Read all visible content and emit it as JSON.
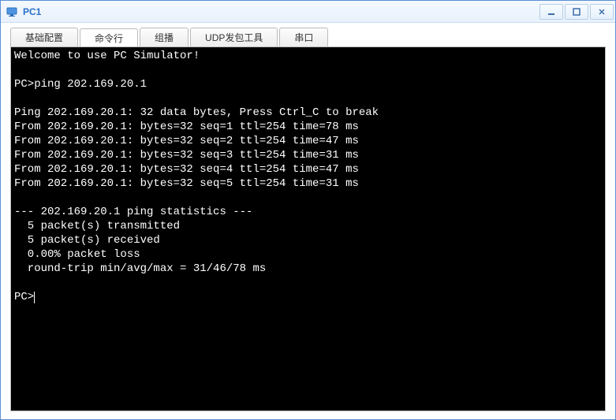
{
  "window": {
    "title": "PC1"
  },
  "tabs": [
    {
      "label": "基础配置",
      "active": false
    },
    {
      "label": "命令行",
      "active": true
    },
    {
      "label": "组播",
      "active": false
    },
    {
      "label": "UDP发包工具",
      "active": false
    },
    {
      "label": "串口",
      "active": false
    }
  ],
  "terminal": {
    "lines": [
      "Welcome to use PC Simulator!",
      "",
      "PC>ping 202.169.20.1",
      "",
      "Ping 202.169.20.1: 32 data bytes, Press Ctrl_C to break",
      "From 202.169.20.1: bytes=32 seq=1 ttl=254 time=78 ms",
      "From 202.169.20.1: bytes=32 seq=2 ttl=254 time=47 ms",
      "From 202.169.20.1: bytes=32 seq=3 ttl=254 time=31 ms",
      "From 202.169.20.1: bytes=32 seq=4 ttl=254 time=47 ms",
      "From 202.169.20.1: bytes=32 seq=5 ttl=254 time=31 ms",
      "",
      "--- 202.169.20.1 ping statistics ---",
      "  5 packet(s) transmitted",
      "  5 packet(s) received",
      "  0.00% packet loss",
      "  round-trip min/avg/max = 31/46/78 ms",
      "",
      "PC>"
    ],
    "prompt": "PC>"
  }
}
